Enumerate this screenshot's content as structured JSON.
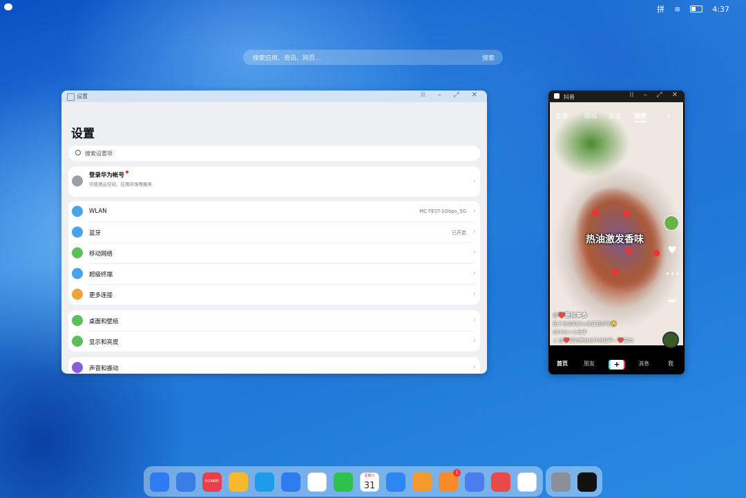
{
  "status_bar": {
    "time": "4:37",
    "input_method": "拼"
  },
  "desktop_search": {
    "placeholder": "搜索应用、资讯、网页...",
    "button": "搜索"
  },
  "settings": {
    "window_title": "设置",
    "heading": "设置",
    "search_placeholder": "搜索设置项",
    "account": {
      "title": "登录华为帐号",
      "subtitle": "可使用云空间、应用市场等服务"
    },
    "network": [
      {
        "label": "WLAN",
        "value": "MC-TEST-1Gbps_5G",
        "color": "#4aa3e8"
      },
      {
        "label": "蓝牙",
        "value": "已开启",
        "color": "#4aa3e8"
      },
      {
        "label": "移动网络",
        "value": "",
        "color": "#5cbf5c"
      },
      {
        "label": "超级终端",
        "value": "",
        "color": "#4aa3e8"
      },
      {
        "label": "更多连接",
        "value": "",
        "color": "#f2a23a"
      }
    ],
    "display": [
      {
        "label": "桌面和壁纸",
        "color": "#5cbf5c"
      },
      {
        "label": "显示和亮度",
        "color": "#5cbf5c"
      }
    ],
    "sound": {
      "label": "声音和振动",
      "color": "#8a5ce0"
    }
  },
  "douyin": {
    "window_title": "抖音",
    "tabs": [
      "直播",
      "同城",
      "关注",
      "推荐"
    ],
    "caption": "热油激发香味",
    "author": "@❤️要尚美食",
    "desc": "茄子没想到这么做还挺好吃🤤",
    "mention": "@DOU+小助手",
    "music": "♫ 由❤️要尚美食创作的原声—❤️要尚",
    "nav": [
      "首页",
      "朋友",
      "+",
      "消息",
      "我"
    ]
  },
  "dock": {
    "apps": [
      {
        "name": "app-grid",
        "color": "#2f7cf0"
      },
      {
        "name": "multi-window",
        "color": "#3b7de8"
      },
      {
        "name": "huawei-appgallery",
        "color": "#e8404a",
        "label": "HUAWEI"
      },
      {
        "name": "files",
        "color": "#f5b82e"
      },
      {
        "name": "browser",
        "color": "#1e9be8"
      },
      {
        "name": "email",
        "color": "#2e7cf0"
      },
      {
        "name": "gallery",
        "color": "#ffffff"
      },
      {
        "name": "messages",
        "color": "#2dc24a"
      },
      {
        "name": "calendar",
        "color": "#ffffff",
        "weekday": "星期六",
        "day": "31"
      },
      {
        "name": "contacts",
        "color": "#2e86f0"
      },
      {
        "name": "docs-viewer",
        "color": "#f29a2e"
      },
      {
        "name": "video",
        "color": "#f58a2a",
        "badge": "1"
      },
      {
        "name": "music",
        "color": "#4a7ef0"
      },
      {
        "name": "books",
        "color": "#e84a4a"
      },
      {
        "name": "wps-office",
        "color": "#ffffff"
      }
    ],
    "recent": [
      {
        "name": "settings-recent",
        "color": "#8a8f98"
      },
      {
        "name": "douyin-recent",
        "color": "#111111"
      }
    ]
  }
}
